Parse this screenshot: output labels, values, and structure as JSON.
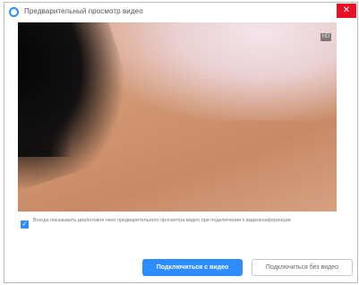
{
  "window": {
    "title": "Предварительный просмотр видео",
    "close_symbol": "✕"
  },
  "icons": {
    "app": "zoom-app-icon",
    "close": "close-icon",
    "check": "checkmark-icon"
  },
  "preview": {
    "camera_tag": "HD"
  },
  "options": {
    "always_show_preview": {
      "checked": true,
      "check_symbol": "✓",
      "label": "Всегда показывать диалоговое окно предварительного просмотра видео при подключении к видеоконференции"
    }
  },
  "buttons": {
    "join_with_video": "Подключиться с видео",
    "join_without_video": "Подключиться без видео"
  },
  "colors": {
    "accent": "#2d8cff",
    "close_button": "#e81123"
  }
}
